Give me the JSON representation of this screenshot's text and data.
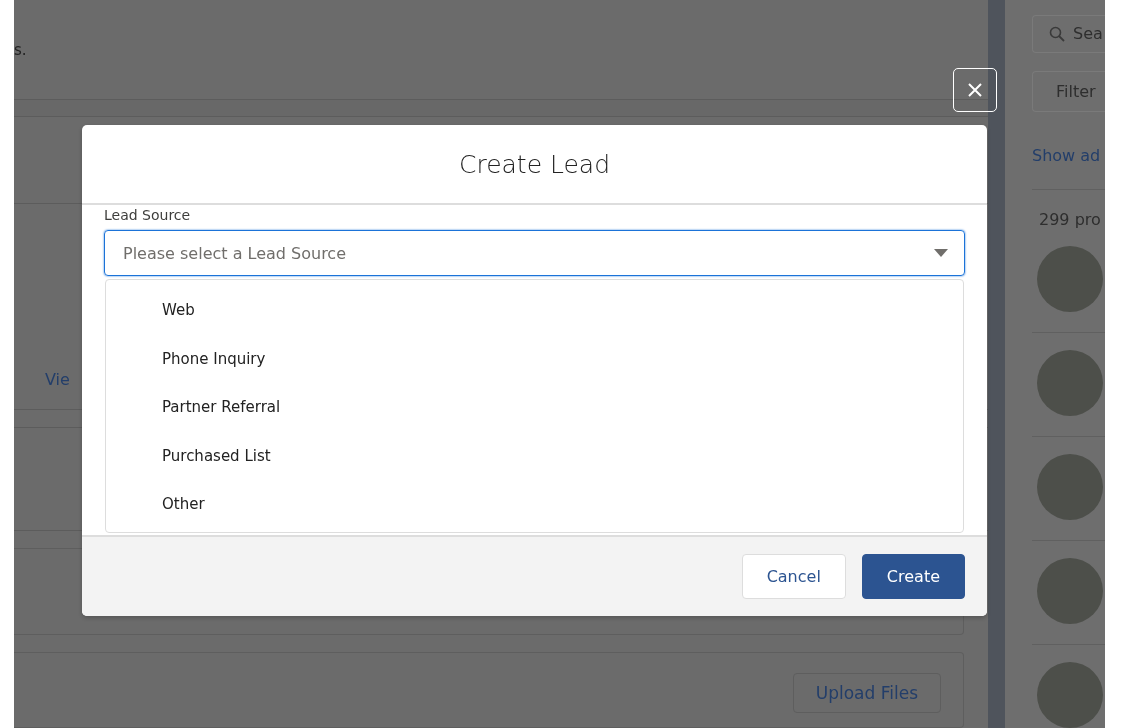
{
  "background": {
    "notice_text": "s.",
    "link": "Vie",
    "upload_button": "Upload Files"
  },
  "sidebar": {
    "search": {
      "placeholder": "Sea"
    },
    "filter": {
      "placeholder": "Filter"
    },
    "link": "Show ad",
    "count": "299 pro"
  },
  "modal": {
    "title": "Create Lead",
    "field": {
      "label": "Lead Source",
      "placeholder": "Please select a Lead Source",
      "expanded": true
    },
    "options": [
      {
        "label": "Web",
        "selected": false
      },
      {
        "label": "Phone Inquiry",
        "selected": false
      },
      {
        "label": "Partner Referral",
        "selected": false
      },
      {
        "label": "Purchased List",
        "selected": false
      },
      {
        "label": "Other",
        "selected": false
      }
    ],
    "buttons": [
      {
        "label": "Cancel",
        "kind": "neutral"
      },
      {
        "label": "Create",
        "kind": "brand"
      }
    ]
  }
}
